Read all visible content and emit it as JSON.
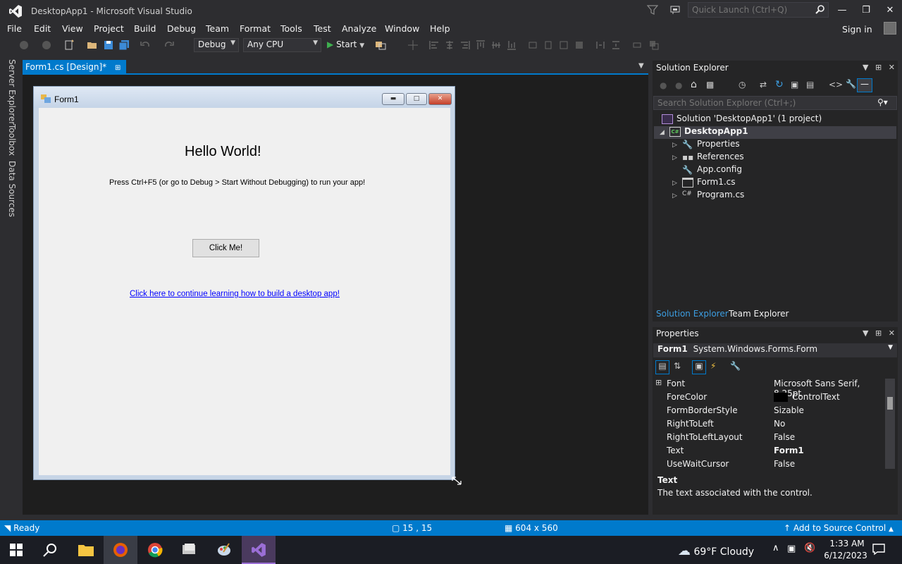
{
  "window": {
    "title": "DesktopApp1 - Microsoft Visual Studio",
    "quick_launch_placeholder": "Quick Launch (Ctrl+Q)",
    "sign_in": "Sign in"
  },
  "menu": [
    "File",
    "Edit",
    "View",
    "Project",
    "Build",
    "Debug",
    "Team",
    "Format",
    "Tools",
    "Test",
    "Analyze",
    "Window",
    "Help"
  ],
  "toolbar": {
    "configuration": "Debug",
    "platform": "Any CPU",
    "start_label": "Start"
  },
  "side_tabs": [
    "Server Explorer",
    "Toolbox",
    "Data Sources"
  ],
  "document_tab": {
    "label": "Form1.cs [Design]*"
  },
  "form": {
    "title": "Form1",
    "heading": "Hello World!",
    "instruction": "Press Ctrl+F5 (or go to Debug > Start Without Debugging) to run your app!",
    "button_label": "Click Me!",
    "link_text": "Click here to continue learning how to build a desktop app!"
  },
  "solution_explorer": {
    "title": "Solution Explorer",
    "search_placeholder": "Search Solution Explorer (Ctrl+;)",
    "solution": "Solution 'DesktopApp1' (1 project)",
    "project": "DesktopApp1",
    "items": [
      "Properties",
      "References",
      "App.config",
      "Form1.cs",
      "Program.cs"
    ],
    "tabs": [
      "Solution Explorer",
      "Team Explorer"
    ]
  },
  "properties": {
    "title": "Properties",
    "object_name": "Form1",
    "object_type": "System.Windows.Forms.Form",
    "rows": [
      {
        "name": "Font",
        "value": "Microsoft Sans Serif, 8.25pt"
      },
      {
        "name": "ForeColor",
        "value": "ControlText"
      },
      {
        "name": "FormBorderStyle",
        "value": "Sizable"
      },
      {
        "name": "RightToLeft",
        "value": "No"
      },
      {
        "name": "RightToLeftLayout",
        "value": "False"
      },
      {
        "name": "Text",
        "value": "Form1"
      },
      {
        "name": "UseWaitCursor",
        "value": "False"
      }
    ],
    "description_title": "Text",
    "description": "The text associated with the control."
  },
  "statusbar": {
    "ready": "Ready",
    "position": "15 , 15",
    "size": "604 x 560",
    "source_control": "Add to Source Control"
  },
  "taskbar": {
    "temperature": "69°F",
    "weather": "Cloudy",
    "time": "1:33 AM",
    "date": "6/12/2023"
  },
  "colors": {
    "accent": "#007acc",
    "background": "#2d2d30",
    "panel": "#252526"
  }
}
